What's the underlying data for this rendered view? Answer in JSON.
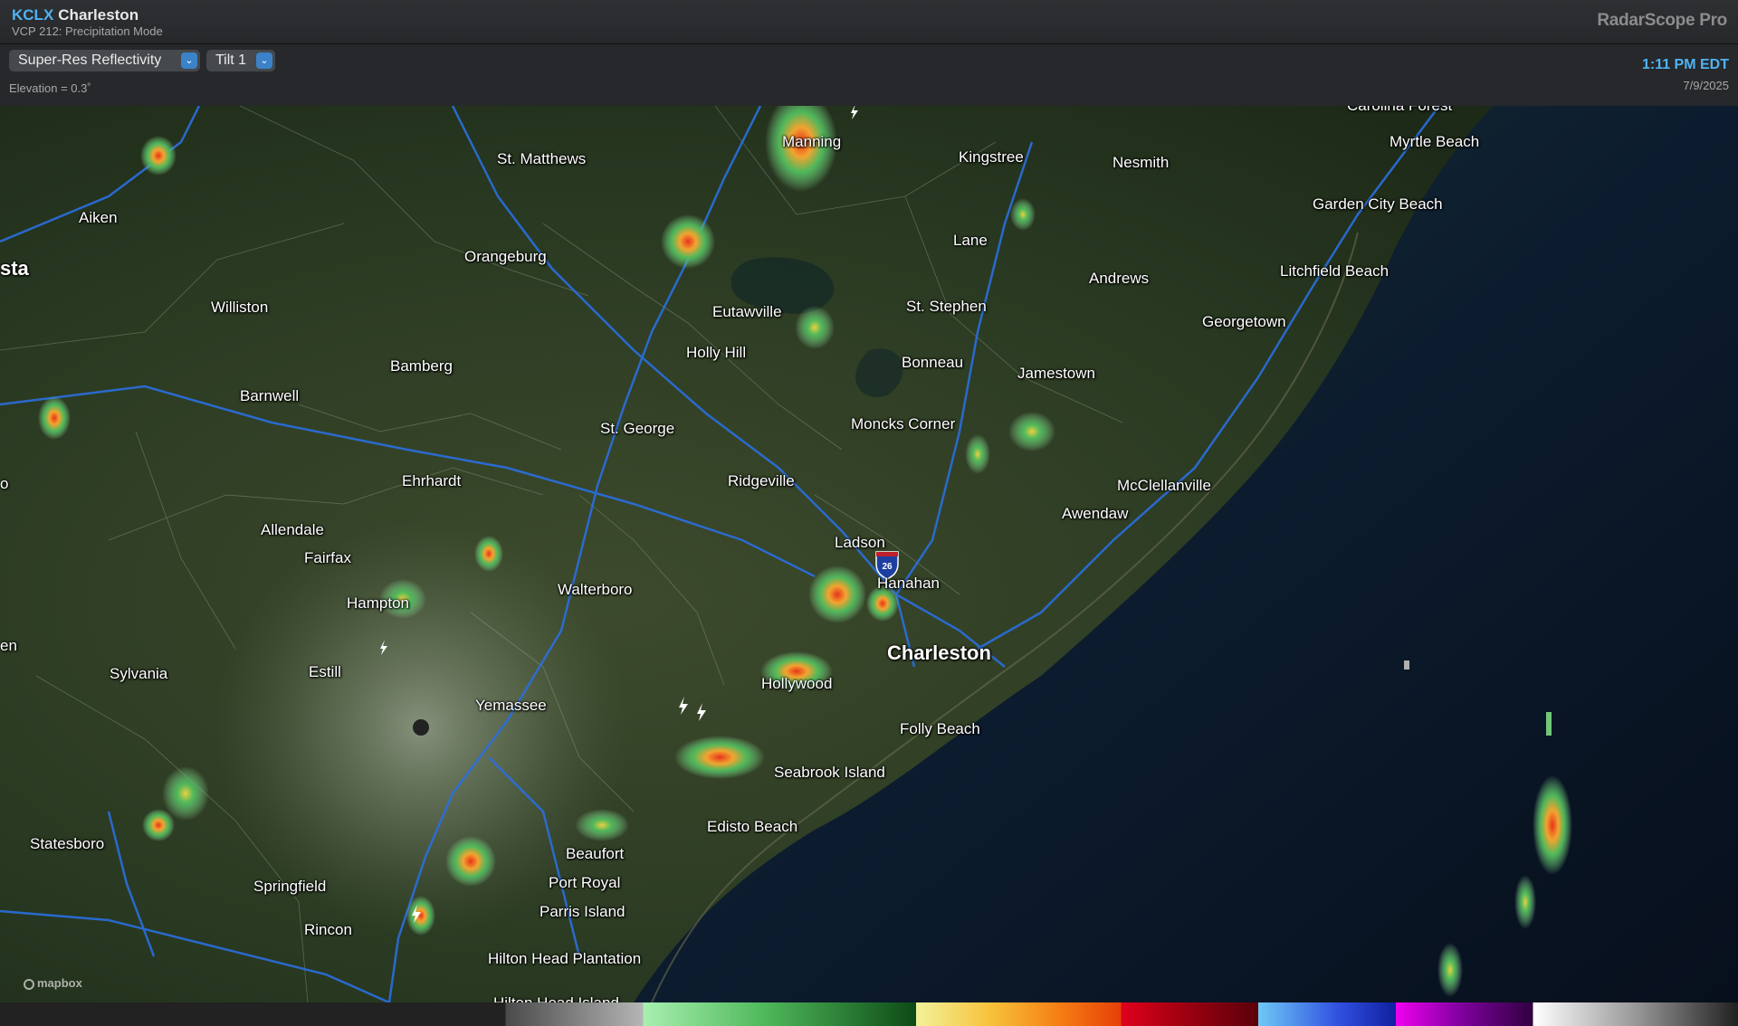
{
  "header": {
    "station_id": "KCLX",
    "station_name": "Charleston",
    "vcp": "VCP 212: Precipitation Mode",
    "app_name": "RadarScope Pro"
  },
  "toolbar": {
    "product": "Super-Res Reflectivity",
    "tilt": "Tilt 1",
    "elevation": "Elevation = 0.3˚",
    "time": "1:11 PM EDT",
    "date": "7/9/2025"
  },
  "map": {
    "attribution": "mapbox",
    "highway_shield": "26",
    "cities": {
      "carolina_forest": "Carolina Forest",
      "myrtle_beach": "Myrtle Beach",
      "manning": "Manning",
      "st_matthews": "St. Matthews",
      "kingstree": "Kingstree",
      "nesmith": "Nesmith",
      "garden_city_beach": "Garden City Beach",
      "aiken": "Aiken",
      "augusta_edge": "sta",
      "orangeburg": "Orangeburg",
      "lane": "Lane",
      "litchfield_beach": "Litchfield Beach",
      "andrews": "Andrews",
      "williston": "Williston",
      "eutawville": "Eutawville",
      "st_stephen": "St. Stephen",
      "georgetown": "Georgetown",
      "holly_hill": "Holly Hill",
      "bamberg": "Bamberg",
      "bonneau": "Bonneau",
      "jamestown": "Jamestown",
      "barnwell": "Barnwell",
      "st_george": "St. George",
      "moncks_corner": "Moncks Corner",
      "ehrhardt": "Ehrhardt",
      "ridgeville": "Ridgeville",
      "mcclellanville": "McClellanville",
      "awendaw": "Awendaw",
      "allendale": "Allendale",
      "ladson": "Ladson",
      "fairfax": "Fairfax",
      "hanahan": "Hanahan",
      "walterboro": "Walterboro",
      "hampton": "Hampton",
      "charleston": "Charleston",
      "sylvania": "Sylvania",
      "estill": "Estill",
      "hollywood": "Hollywood",
      "yemassee": "Yemassee",
      "folly_beach": "Folly Beach",
      "seabrook_island": "Seabrook Island",
      "edisto_beach": "Edisto Beach",
      "statesboro": "Statesboro",
      "beaufort": "Beaufort",
      "port_royal": "Port Royal",
      "springfield": "Springfield",
      "parris_island": "Parris Island",
      "rincon": "Rincon",
      "hilton_head_plantation": "Hilton Head Plantation",
      "hilton_head_island": "Hilton Head Island",
      "left_edge_o": "o",
      "left_edge_en": "en"
    }
  },
  "colors": {
    "accent": "#4fb3f3",
    "interstate": "#2a6fe0",
    "ocean": "#0b1a2c"
  }
}
